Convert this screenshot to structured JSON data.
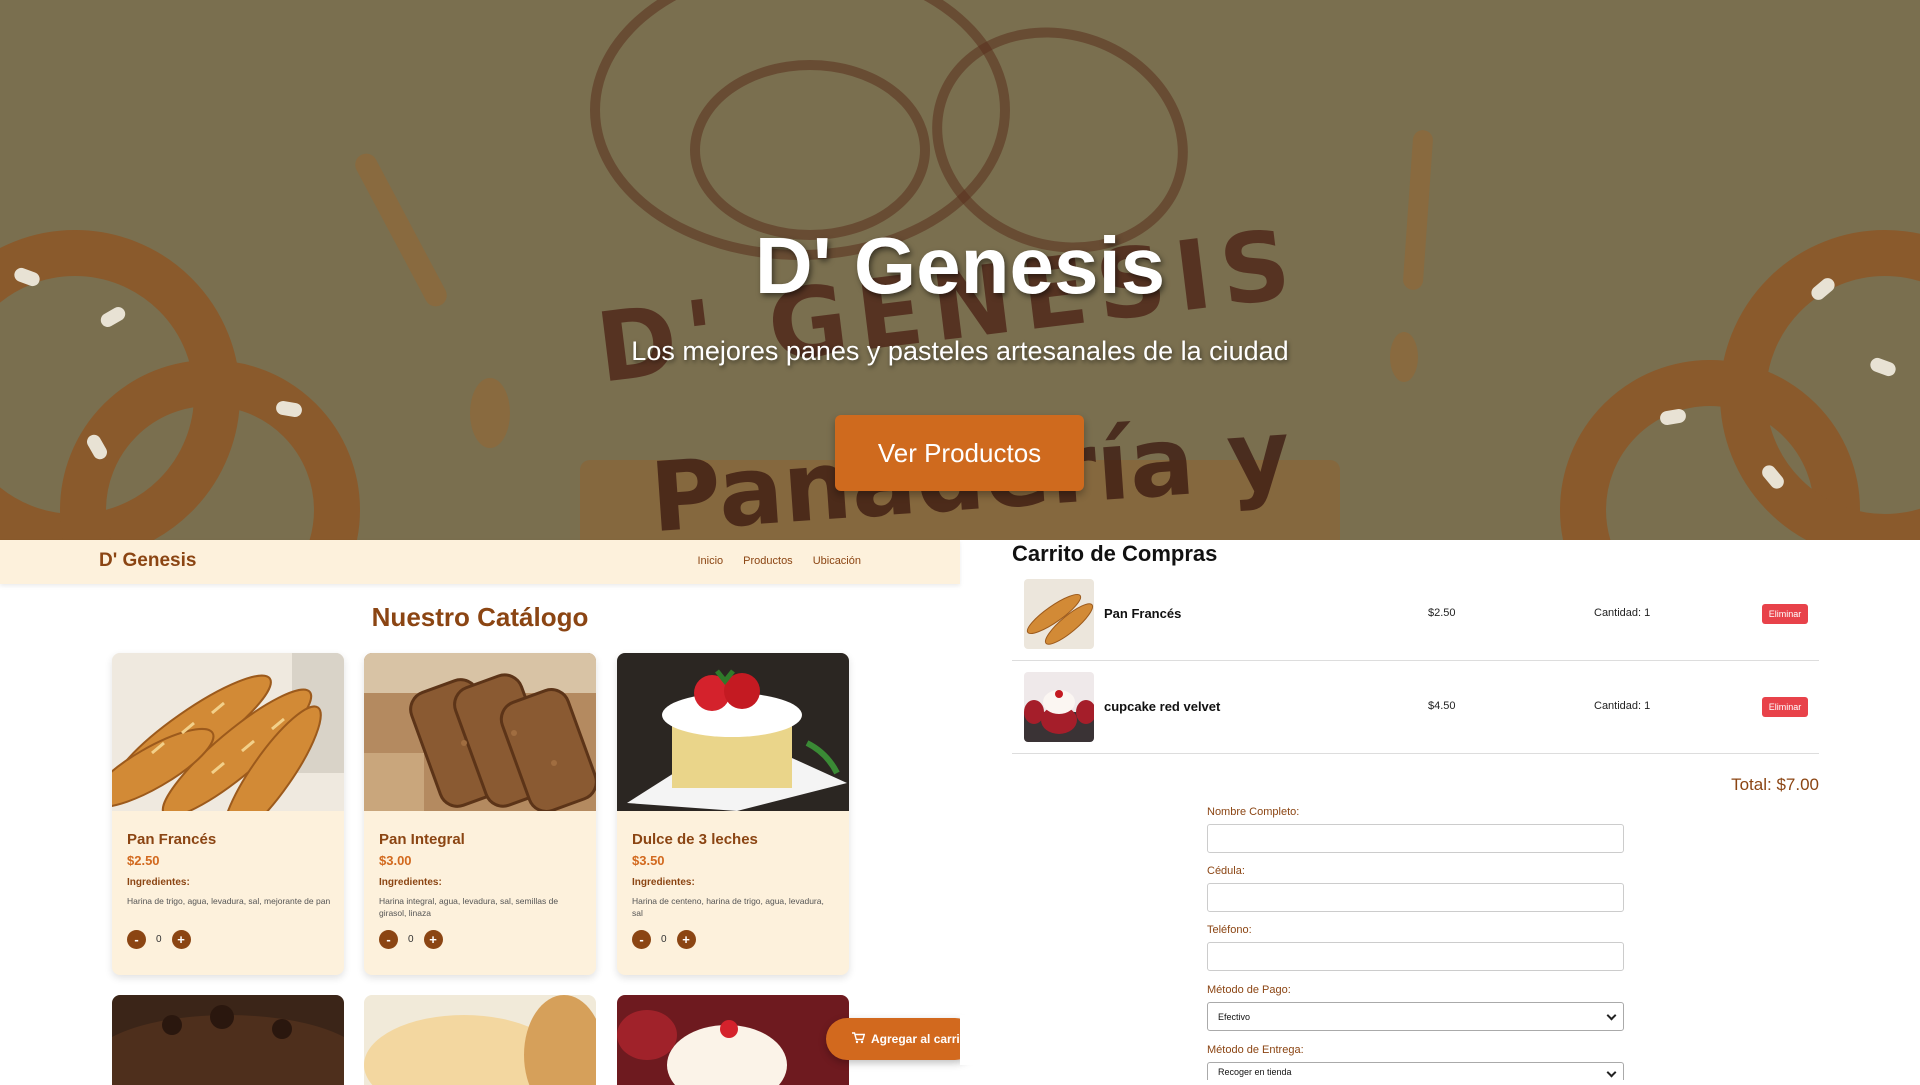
{
  "hero": {
    "title": "D' Genesis",
    "subtitle": "Los mejores panes y pasteles artesanales de la ciudad",
    "cta_label": "Ver Productos",
    "bg_logo_text_1": "D' GENESIS",
    "bg_logo_text_2": "Panadería y"
  },
  "navbar": {
    "brand": "D' Genesis",
    "links": [
      "Inicio",
      "Productos",
      "Ubicación"
    ]
  },
  "catalog": {
    "title": "Nuestro Catálogo",
    "ingredients_label": "Ingredientes:",
    "products": [
      {
        "name": "Pan Francés",
        "price": "$2.50",
        "ingredients": "Harina de trigo, agua, levadura, sal, mejorante de pan",
        "qty": "0",
        "image": "baguette-photo"
      },
      {
        "name": "Pan Integral",
        "price": "$3.00",
        "ingredients": "Harina integral, agua, levadura, sal, semillas de girasol, linaza",
        "qty": "0",
        "image": "wholegrain-bread-photo"
      },
      {
        "name": "Dulce de 3 leches",
        "price": "$3.50",
        "ingredients": "Harina de centeno, harina de trigo, agua, levadura, sal",
        "qty": "0",
        "image": "tres-leches-cake-photo"
      }
    ],
    "minus_label": "-",
    "plus_label": "+",
    "add_to_cart_label": "Agregar al carri",
    "add_to_cart_icon": "cart-icon"
  },
  "cart": {
    "title": "Carrito de Compras",
    "items": [
      {
        "name": "Pan Francés",
        "price": "$2.50",
        "qty": "Cantidad: 1",
        "remove_label": "Eliminar"
      },
      {
        "name": "cupcake red velvet",
        "price": "$4.50",
        "qty": "Cantidad: 1",
        "remove_label": "Eliminar"
      }
    ],
    "total": "Total: $7.00"
  },
  "form": {
    "name_label": "Nombre Completo:",
    "id_label": "Cédula:",
    "phone_label": "Teléfono:",
    "payment_label": "Método de Pago:",
    "payment_value": "Efectivo",
    "delivery_label": "Método de Entrega:",
    "delivery_value": "Recoger en tienda"
  },
  "colors": {
    "brand_brown": "#8b4513",
    "accent_orange": "#d2691e",
    "hero_bg": "#7a6f4f",
    "card_bg": "#fdf1dc",
    "danger": "#e8424a"
  }
}
